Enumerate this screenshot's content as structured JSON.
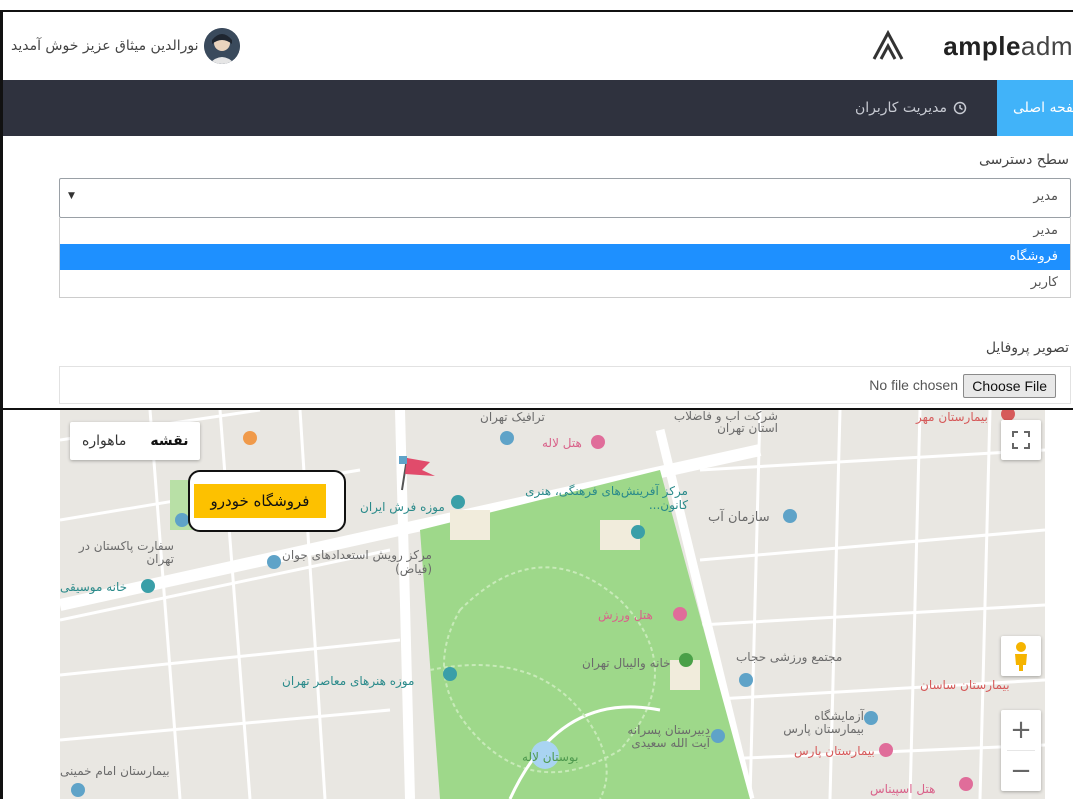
{
  "header": {
    "brand_bold": "ample",
    "brand_light": "adm",
    "user_greeting": "نورالدین میثاق عزیز خوش آمدید"
  },
  "nav": {
    "home": "صفحه اصلی",
    "users": "مدیریت کاربران"
  },
  "form": {
    "access_label": "سطح دسترسی",
    "access_selected": "مدیر",
    "access_options": [
      "مدیر",
      "فروشگاه",
      "کاربر"
    ],
    "highlighted_option": "فروشگاه",
    "profile_label": "تصویر پروفایل",
    "file_button": "Choose File",
    "file_status": "No file chosen"
  },
  "map": {
    "type_map": "نقشه",
    "type_satellite": "ماهواره",
    "marker_label": "فروشگاه خودرو",
    "places": [
      {
        "name": "ترافیک تهران",
        "color": "gray"
      },
      {
        "name": "شرکت آب و فاضلاب استان تهران",
        "color": "gray"
      },
      {
        "name": "بیمارستان مهر",
        "color": "red"
      },
      {
        "name": "هتل لاله",
        "color": "pink"
      },
      {
        "name": "مرکز آفرینش‌های فرهنگی، هنری کانون...",
        "color": "teal"
      },
      {
        "name": "موزه فرش ایران",
        "color": "teal"
      },
      {
        "name": "سازمان آب",
        "color": "gray"
      },
      {
        "name": "مرکز رویش استعدادهای جوان (فیاض)",
        "color": "gray"
      },
      {
        "name": "سفارت پاکستان در تهران",
        "color": "gray"
      },
      {
        "name": "خانه موسیقی",
        "color": "teal"
      },
      {
        "name": "هتل ورزش",
        "color": "pink"
      },
      {
        "name": "خانه والیبال تهران",
        "color": "gray"
      },
      {
        "name": "مجتمع ورزشی حجاب",
        "color": "gray"
      },
      {
        "name": "موزه هنرهای معاصر تهران",
        "color": "teal"
      },
      {
        "name": "بیمارستان ساسان",
        "color": "red"
      },
      {
        "name": "آزمایشگاه بیمارستان پارس",
        "color": "gray"
      },
      {
        "name": "بیمارستان پارس",
        "color": "red"
      },
      {
        "name": "دبیرستان پسرانه آیت الله سعیدی",
        "color": "gray"
      },
      {
        "name": "بوستان لاله",
        "color": "green"
      },
      {
        "name": "بیمارستان امام خمینی",
        "color": "gray"
      },
      {
        "name": "هتل اسپیناس",
        "color": "pink"
      }
    ]
  }
}
